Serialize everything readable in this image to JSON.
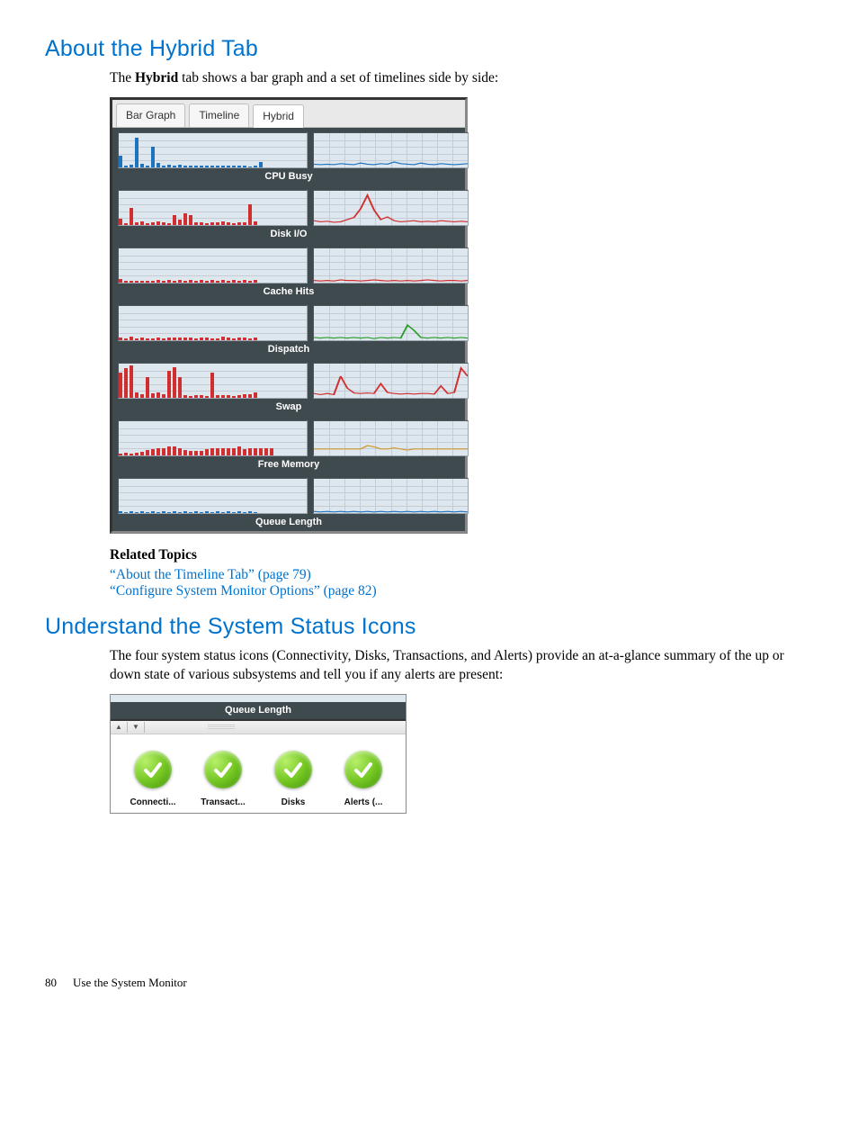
{
  "section1": {
    "heading": "About the Hybrid Tab",
    "intro_pre": "The ",
    "intro_bold": "Hybrid",
    "intro_post": " tab shows a bar graph and a set of timelines side by side:"
  },
  "hybrid": {
    "tabs": {
      "bar": "Bar Graph",
      "timeline": "Timeline",
      "hybrid": "Hybrid"
    },
    "metrics": [
      "CPU Busy",
      "Disk I/O",
      "Cache Hits",
      "Dispatch",
      "Swap",
      "Free Memory",
      "Queue Length"
    ]
  },
  "chart_data": [
    {
      "name": "CPU Busy",
      "type": "bar",
      "bars": [
        22,
        4,
        5,
        55,
        6,
        4,
        38,
        8,
        4,
        5,
        3,
        5,
        4,
        4,
        4,
        3,
        4,
        4,
        4,
        3,
        4,
        4,
        4,
        3,
        2,
        3,
        10
      ],
      "timeline": [
        6,
        5,
        6,
        5,
        7,
        6,
        5,
        8,
        6,
        5,
        7,
        6,
        10,
        7,
        6,
        5,
        8,
        6,
        5,
        7,
        6,
        5,
        6,
        7
      ],
      "colors": {
        "bar": "#1e73be",
        "line": "#1e73be"
      }
    },
    {
      "name": "Disk I/O",
      "type": "bar",
      "bars": [
        12,
        4,
        32,
        5,
        6,
        4,
        5,
        6,
        5,
        4,
        18,
        10,
        22,
        18,
        5,
        5,
        4,
        5,
        5,
        6,
        5,
        4,
        5,
        5,
        38,
        6
      ],
      "timeline": [
        8,
        6,
        7,
        5,
        6,
        10,
        14,
        30,
        55,
        28,
        10,
        15,
        8,
        6,
        7,
        8,
        6,
        7,
        6,
        8,
        7,
        6,
        7,
        6
      ],
      "colors": {
        "bar": "#d12f2f",
        "line": "#d12f2f"
      }
    },
    {
      "name": "Cache Hits",
      "type": "bar",
      "bars": [
        6,
        4,
        3,
        4,
        3,
        4,
        3,
        5,
        4,
        5,
        4,
        5,
        4,
        5,
        4,
        5,
        4,
        5,
        4,
        5,
        4,
        5,
        4,
        5,
        4,
        5
      ],
      "timeline": [
        4,
        3,
        4,
        3,
        5,
        4,
        4,
        3,
        4,
        5,
        4,
        3,
        4,
        3,
        4,
        3,
        4,
        5,
        4,
        3,
        4,
        4,
        3,
        4
      ],
      "colors": {
        "bar": "#d12f2f",
        "line": "#d12f2f"
      }
    },
    {
      "name": "Dispatch",
      "type": "bar",
      "bars": [
        5,
        4,
        6,
        4,
        5,
        3,
        4,
        5,
        4,
        5,
        5,
        5,
        5,
        5,
        4,
        5,
        5,
        3,
        4,
        6,
        5,
        4,
        5,
        5,
        4,
        5
      ],
      "timeline": [
        5,
        4,
        5,
        4,
        5,
        4,
        5,
        4,
        5,
        3,
        5,
        4,
        5,
        4,
        28,
        18,
        5,
        4,
        5,
        4,
        5,
        4,
        5,
        4
      ],
      "colors": {
        "bar": "#d12f2f",
        "line": "#2f9e2f"
      }
    },
    {
      "name": "Swap",
      "type": "bar",
      "bars": [
        48,
        56,
        62,
        10,
        6,
        40,
        8,
        10,
        6,
        52,
        58,
        40,
        5,
        4,
        5,
        5,
        4,
        48,
        5,
        5,
        5,
        4,
        5,
        6,
        6,
        10
      ],
      "timeline": [
        8,
        6,
        8,
        6,
        40,
        18,
        9,
        8,
        9,
        8,
        26,
        10,
        8,
        7,
        8,
        7,
        8,
        8,
        7,
        22,
        8,
        10,
        55,
        40
      ],
      "colors": {
        "bar": "#d12f2f",
        "line": "#d12f2f"
      }
    },
    {
      "name": "Free Memory",
      "type": "bar",
      "bars": [
        4,
        5,
        4,
        5,
        6,
        10,
        12,
        14,
        14,
        16,
        16,
        14,
        10,
        8,
        8,
        8,
        12,
        14,
        14,
        14,
        14,
        14,
        16,
        12,
        14,
        14,
        14,
        14,
        14
      ],
      "timeline": [
        12,
        12,
        12,
        12,
        12,
        12,
        12,
        12,
        18,
        16,
        12,
        12,
        14,
        12,
        10,
        12,
        12,
        12,
        12,
        12,
        12,
        12,
        12,
        12
      ],
      "colors": {
        "bar": "#d12f2f",
        "line": "#d19a2f"
      }
    },
    {
      "name": "Queue Length",
      "type": "bar",
      "bars": [
        3,
        2,
        3,
        2,
        3,
        2,
        3,
        2,
        3,
        2,
        3,
        2,
        3,
        2,
        3,
        2,
        3,
        2,
        3,
        2,
        3,
        2,
        3,
        2,
        3,
        2
      ],
      "timeline": [
        3,
        2,
        3,
        2,
        3,
        2,
        3,
        2,
        3,
        2,
        3,
        2,
        3,
        2,
        3,
        2,
        3,
        2,
        3,
        2,
        3,
        2,
        3,
        2
      ],
      "colors": {
        "bar": "#1e73be",
        "line": "#1e73be"
      }
    }
  ],
  "related": {
    "heading": "Related Topics",
    "links": [
      "“About the Timeline Tab” (page 79)",
      "“Configure System Monitor Options” (page 82)"
    ]
  },
  "section2": {
    "heading": "Understand the System Status Icons",
    "intro": "The four system status icons (Connectivity, Disks, Transactions, and Alerts) provide an at-a-glance summary of the up or down state of various subsystems and tell you if any alerts are present:"
  },
  "status": {
    "header": "Queue Length",
    "icons": [
      {
        "key": "connectivity",
        "label": "Connecti..."
      },
      {
        "key": "transactions",
        "label": "Transact..."
      },
      {
        "key": "disks",
        "label": "Disks"
      },
      {
        "key": "alerts",
        "label": "Alerts  (..."
      }
    ]
  },
  "footer": {
    "page": "80",
    "title": "Use the System Monitor"
  }
}
